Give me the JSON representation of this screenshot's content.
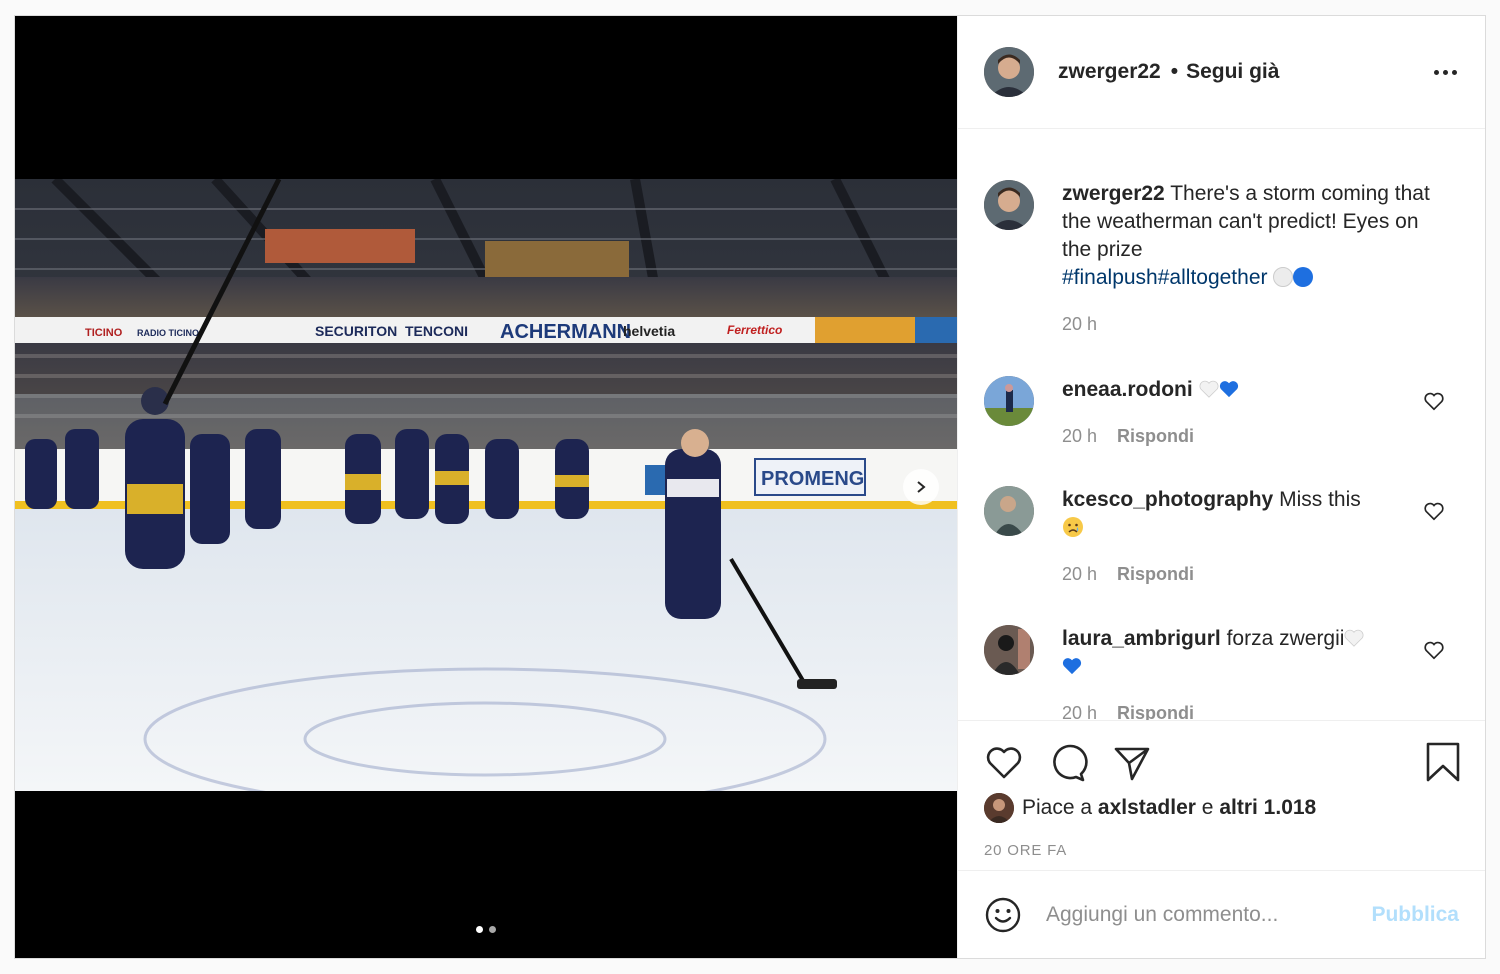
{
  "header": {
    "username": "zwerger22",
    "separator": "•",
    "follow_label": "Segui già"
  },
  "caption": {
    "username": "zwerger22",
    "text": "There's a storm coming that the weatherman can't predict! Eyes on the prize",
    "hashtags": [
      "#finalpush",
      "#alltogether"
    ],
    "emoji": [
      "white-circle",
      "blue-circle"
    ],
    "time": "20 h"
  },
  "comments": [
    {
      "username": "eneaa.rodoni",
      "text": "",
      "emoji": [
        "white-heart",
        "blue-heart"
      ],
      "time": "20 h",
      "reply_label": "Rispondi"
    },
    {
      "username": "kcesco_photography",
      "text": "Miss this",
      "emoji": [
        "crying-face"
      ],
      "time": "20 h",
      "reply_label": "Rispondi"
    },
    {
      "username": "laura_ambrigurl",
      "text": "forza zwergii",
      "emoji": [
        "white-heart",
        "blue-heart"
      ],
      "time": "20 h",
      "reply_label": "Rispondi"
    }
  ],
  "likes": {
    "prefix": "Piace a",
    "user": "axlstadler",
    "connector": "e",
    "others": "altri 1.018"
  },
  "timestamp": "20 ORE FA",
  "add_comment": {
    "placeholder": "Aggiungi un commento...",
    "post_label": "Pubblica"
  },
  "carousel": {
    "current": 1,
    "total": 2
  },
  "photo": {
    "banners": [
      "SECURITON",
      "TENCONI",
      "ACHERMANN",
      "helvetia",
      "Ferrettico",
      "PROMENG",
      "RADIO TICINO",
      "TICINO"
    ]
  },
  "colors": {
    "hashtag": "#00376b",
    "muted": "#8e8e8e",
    "publish_disabled": "#b2dffc",
    "heart_blue": "#1e6fe0"
  }
}
